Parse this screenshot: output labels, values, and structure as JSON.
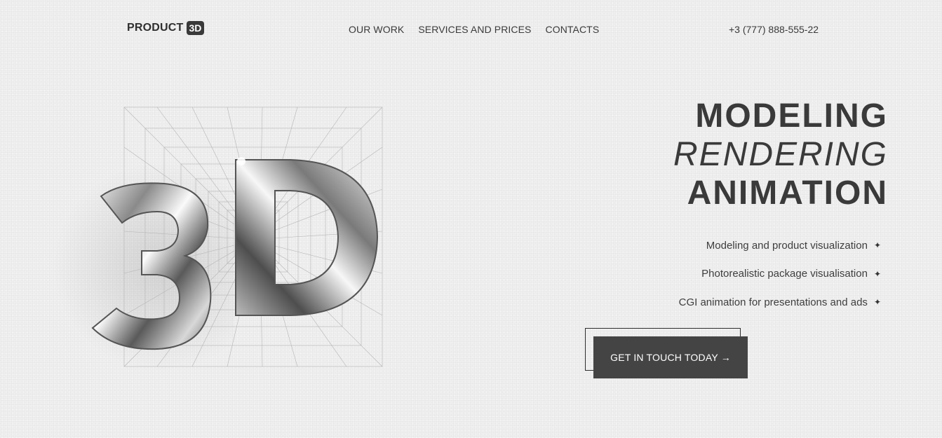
{
  "header": {
    "logo_text": "PRODUCT",
    "logo_badge": "3D",
    "nav": [
      "OUR WORK",
      "SERVICES AND PRICES",
      "CONTACTS"
    ],
    "phone": "+3 (777) 888-555-22"
  },
  "hero": {
    "headline": [
      "MODELING",
      "RENDERING",
      "ANIMATION"
    ],
    "services": [
      "Modeling and product visualization",
      "Photorealistic package visualisation",
      "CGI animation for presentations and ads"
    ],
    "service_marker": "✦",
    "cta_label": "GET IN TOUCH TODAY →",
    "visual_text": "3D"
  },
  "colors": {
    "background": "#efefef",
    "text": "#3a3a3a",
    "button": "#444444"
  }
}
